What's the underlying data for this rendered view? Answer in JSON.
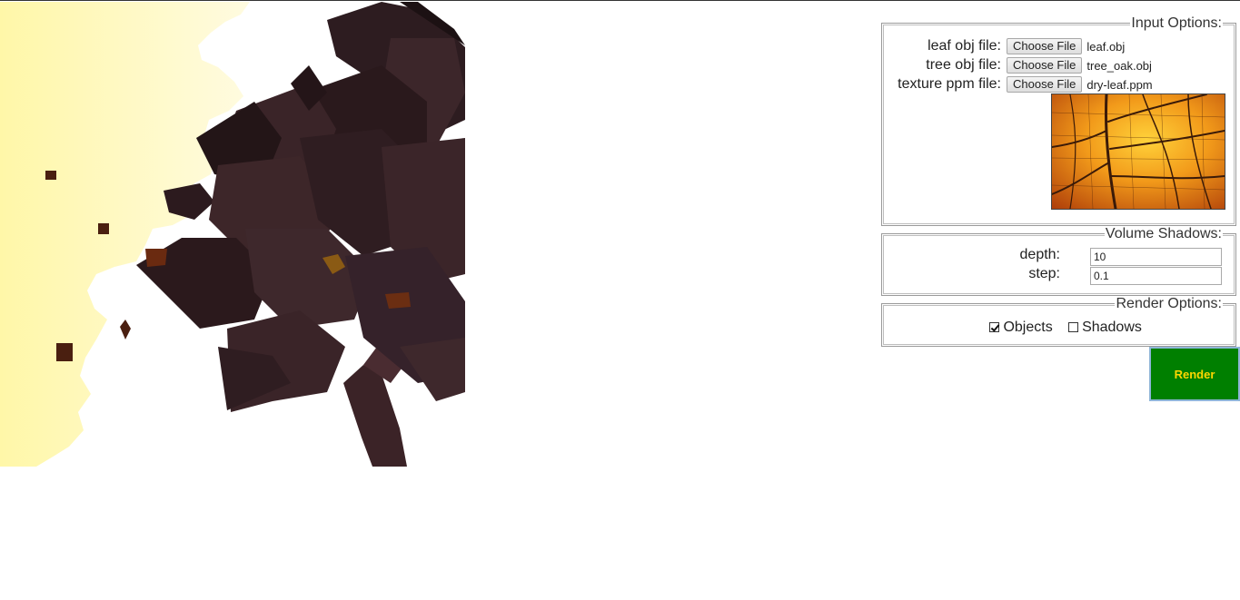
{
  "input_options": {
    "legend": "Input Options:",
    "leaf_label": "leaf obj file:",
    "leaf_button": "Choose File",
    "leaf_file": "leaf.obj",
    "tree_label": "tree obj file:",
    "tree_button": "Choose File",
    "tree_file": "tree_oak.obj",
    "texture_label": "texture ppm file:",
    "texture_button": "Choose File",
    "texture_file": "dry-leaf.ppm"
  },
  "volume_shadows": {
    "legend": "Volume Shadows:",
    "depth_label": "depth:",
    "depth_value": "10",
    "step_label": "step:",
    "step_value": "0.1"
  },
  "render_options": {
    "legend": "Render Options:",
    "objects_label": "Objects",
    "objects_checked": true,
    "shadows_label": "Shadows",
    "shadows_checked": false
  },
  "render_button": "Render",
  "colors": {
    "render_bg": "#007f00",
    "render_text": "#ffd700",
    "sky": "#fff6b0",
    "foliage": "#3a2428"
  }
}
